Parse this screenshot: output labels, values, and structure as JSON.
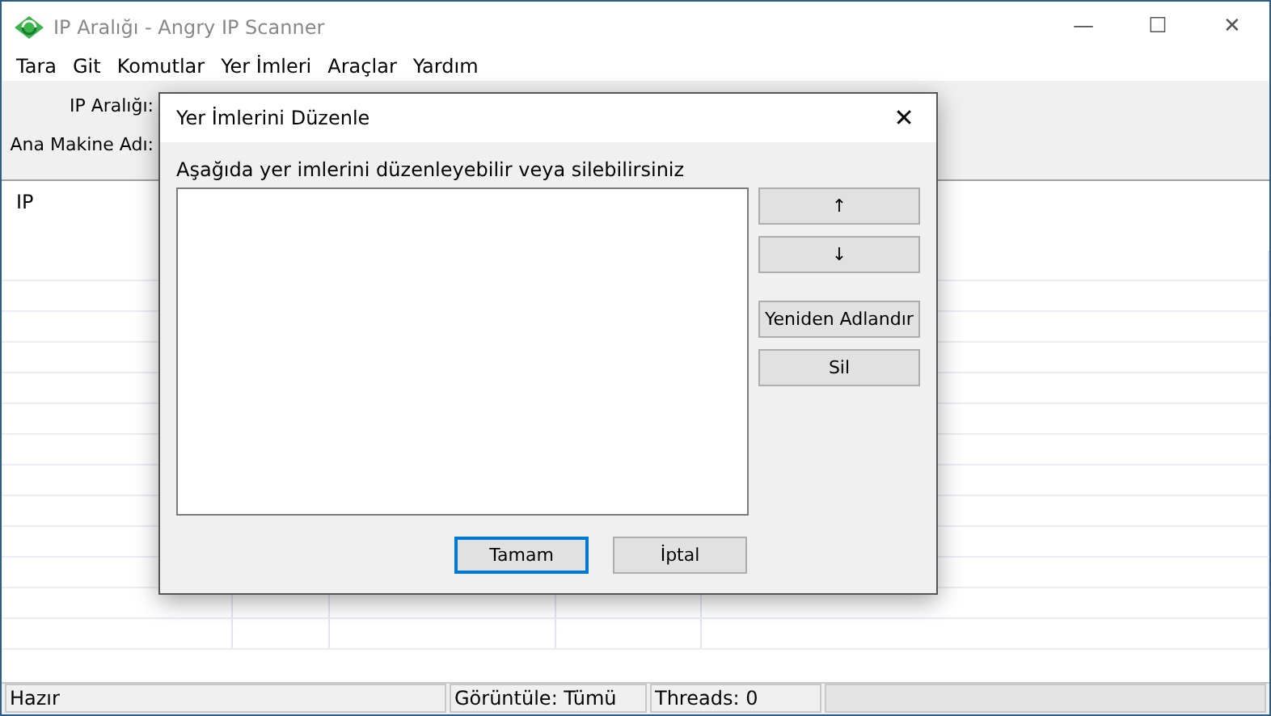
{
  "window": {
    "title": "IP Aralığı - Angry IP Scanner",
    "controls": [
      "—",
      "☐",
      "✕"
    ]
  },
  "menu": [
    "Tara",
    "Git",
    "Komutlar",
    "Yer İmleri",
    "Araçlar",
    "Yardım"
  ],
  "toolbar": {
    "labels": [
      "IP Aralığı:",
      "Ana Makine Adı:"
    ]
  },
  "table": {
    "columns": [
      "IP"
    ]
  },
  "status_bar": [
    "Hazır",
    "Görüntüle: Tümü",
    "Threads: 0"
  ],
  "dialog": {
    "title": "Yer İmlerini Düzenle",
    "close": "✕",
    "instruction": "Aşağıda yer imlerini düzenleyebilir veya silebilirsiniz",
    "move_buttons": [
      "↑",
      "↓"
    ],
    "action_buttons": [
      "Yeniden Adlandır",
      "Sil"
    ],
    "buttons": [
      {
        "label": "Tamam",
        "default": true
      },
      {
        "label": "İptal",
        "default": false
      }
    ]
  }
}
